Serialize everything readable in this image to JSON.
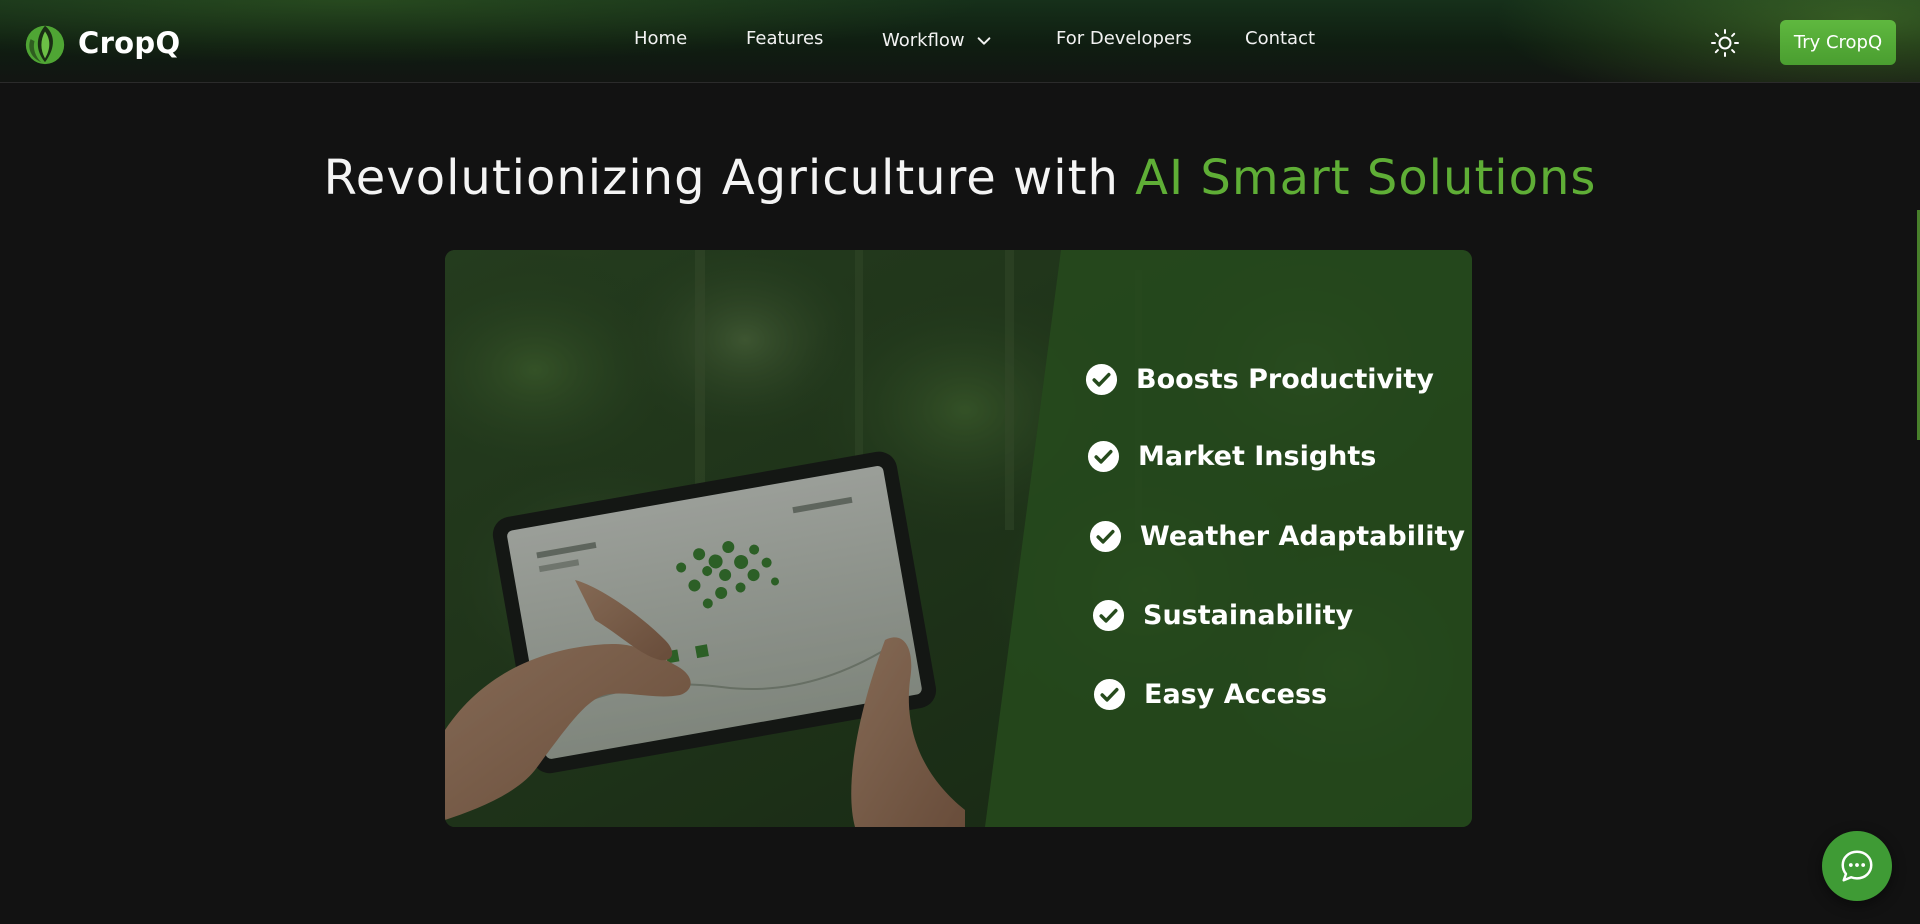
{
  "brand": {
    "name": "CropQ"
  },
  "nav": {
    "items": [
      {
        "label": "Home"
      },
      {
        "label": "Features"
      },
      {
        "label": "Workflow",
        "has_dropdown": true
      },
      {
        "label": "For Developers"
      },
      {
        "label": "Contact"
      }
    ],
    "theme_toggle_icon": "sun-icon",
    "cta_label": "Try CropQ"
  },
  "hero": {
    "title_main": "Revolutionizing Agriculture with ",
    "title_accent": "AI Smart Solutions",
    "image_icon": "farmer-tablet-photo",
    "benefits": [
      {
        "label": "Boosts Productivity",
        "icon": "check-circle-icon"
      },
      {
        "label": "Market Insights",
        "icon": "check-circle-icon"
      },
      {
        "label": "Weather Adaptability",
        "icon": "check-circle-icon"
      },
      {
        "label": "Sustainability",
        "icon": "check-circle-icon"
      },
      {
        "label": "Easy Access",
        "icon": "check-circle-icon"
      }
    ]
  },
  "chat": {
    "icon": "chat-bubble-icon"
  },
  "colors": {
    "accent": "#5fae36",
    "cta": "#4ea633",
    "background": "#121212",
    "chat": "#3f9b35"
  }
}
